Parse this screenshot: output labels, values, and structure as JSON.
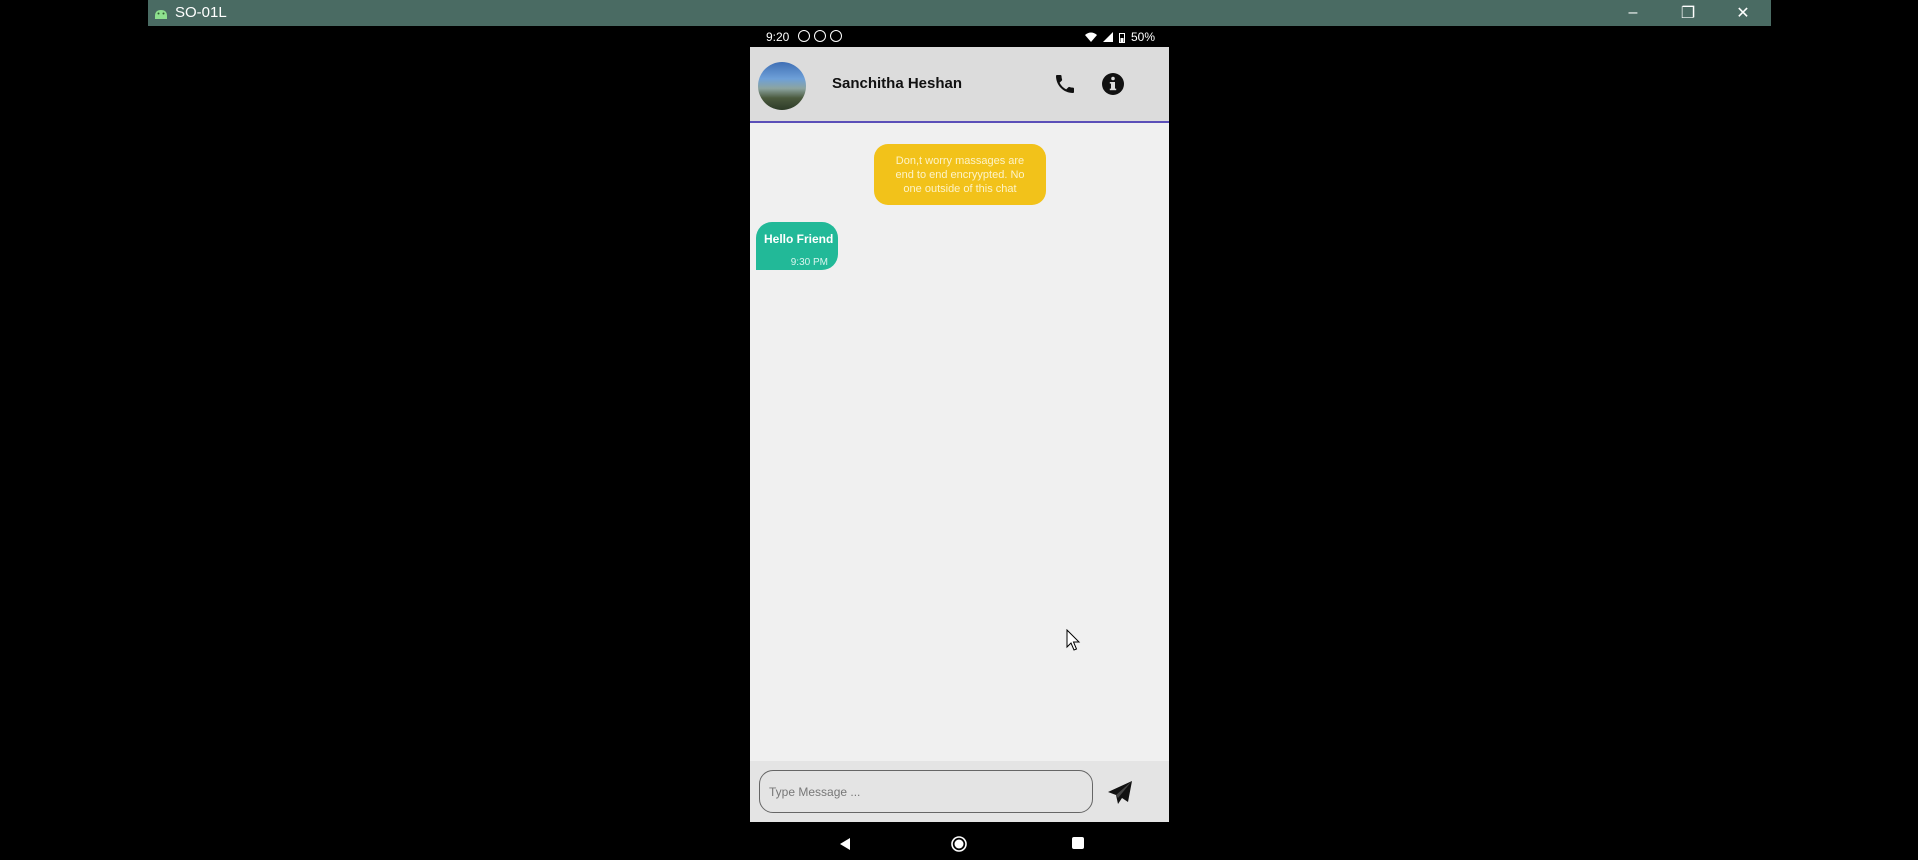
{
  "window": {
    "title": "SO-01L",
    "minimize": "–",
    "maximize": "❐",
    "close": "✕"
  },
  "status_bar": {
    "time": "9:20",
    "battery": "50%"
  },
  "chat": {
    "contact_name": "Sanchitha Heshan",
    "encryption_notice": "Don,t worry massages are end to end encryypted. No one outside of this chat",
    "messages": [
      {
        "text": "Hello Friend",
        "time": "9:30 PM"
      }
    ]
  },
  "composer": {
    "placeholder": "Type Message ..."
  },
  "colors": {
    "titlebar": "#4a6b63",
    "header_border": "#5b4fb8",
    "notice_bubble": "#f2c21a",
    "message_bubble": "#22b998"
  },
  "icons": [
    "android-icon",
    "phone-icon",
    "info-icon",
    "send-icon",
    "back-icon",
    "home-icon",
    "recent-apps-icon"
  ]
}
